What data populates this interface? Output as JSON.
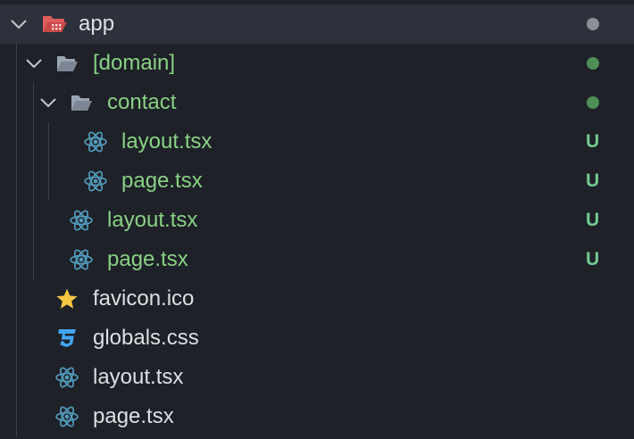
{
  "tree": {
    "app": {
      "label": "app",
      "dot_color": "#8b8f96"
    },
    "domain": {
      "label": "[domain]",
      "dot_color": "#4f8f56"
    },
    "contact": {
      "label": "contact",
      "dot_color": "#4f8f56"
    },
    "contact_layout": {
      "label": "layout.tsx",
      "status": "U"
    },
    "contact_page": {
      "label": "page.tsx",
      "status": "U"
    },
    "domain_layout": {
      "label": "layout.tsx",
      "status": "U"
    },
    "domain_page": {
      "label": "page.tsx",
      "status": "U"
    },
    "favicon": {
      "label": "favicon.ico"
    },
    "globals": {
      "label": "globals.css"
    },
    "app_layout": {
      "label": "layout.tsx"
    },
    "app_page": {
      "label": "page.tsx"
    }
  },
  "colors": {
    "background": "#1e2127",
    "selected_row": "#2c313c",
    "untracked_text": "#89d185",
    "untracked_badge": "#73c991",
    "react_icon": "#519aba",
    "css_icon": "#42a5f5",
    "favicon_icon": "#f5c842",
    "app_folder_icon": "#e05d5d",
    "folder_icon": "#9aa5b4"
  },
  "icons": {
    "app": "app-folder-open-icon",
    "folder": "folder-open-icon",
    "tsx": "react-icon",
    "ico": "star-icon",
    "css": "css3-icon",
    "expand": "chevron-down-icon"
  }
}
